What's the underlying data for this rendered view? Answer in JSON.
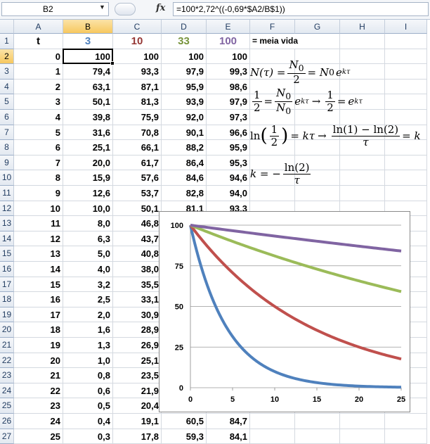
{
  "formula_bar": {
    "name_box": "B2",
    "fx": "fx",
    "formula": "=100*2,72^((-0,69*$A2/B$1))"
  },
  "columns": [
    "A",
    "B",
    "C",
    "D",
    "E",
    "F",
    "G",
    "H",
    "I"
  ],
  "selected_column": "B",
  "selected_row": 2,
  "header_row": {
    "A": "t",
    "B": "3",
    "C": "10",
    "D": "33",
    "E": "100",
    "F": "= meia vida"
  },
  "header_colors": {
    "B": "#4f81bd",
    "C": "#953735",
    "D": "#77933c",
    "E": "#8064a2"
  },
  "rows": [
    [
      "0",
      "100",
      "100",
      "100",
      "100"
    ],
    [
      "1",
      "79,4",
      "93,3",
      "97,9",
      "99,3"
    ],
    [
      "2",
      "63,1",
      "87,1",
      "95,9",
      "98,6"
    ],
    [
      "3",
      "50,1",
      "81,3",
      "93,9",
      "97,9"
    ],
    [
      "4",
      "39,8",
      "75,9",
      "92,0",
      "97,3"
    ],
    [
      "5",
      "31,6",
      "70,8",
      "90,1",
      "96,6"
    ],
    [
      "6",
      "25,1",
      "66,1",
      "88,2",
      "95,9"
    ],
    [
      "7",
      "20,0",
      "61,7",
      "86,4",
      "95,3"
    ],
    [
      "8",
      "15,9",
      "57,6",
      "84,6",
      "94,6"
    ],
    [
      "9",
      "12,6",
      "53,7",
      "82,8",
      "94,0"
    ],
    [
      "10",
      "10,0",
      "50,1",
      "81,1",
      "93,3"
    ],
    [
      "11",
      "8,0",
      "46,8",
      "",
      ""
    ],
    [
      "12",
      "6,3",
      "43,7",
      "",
      ""
    ],
    [
      "13",
      "5,0",
      "40,8",
      "",
      ""
    ],
    [
      "14",
      "4,0",
      "38,0",
      "",
      ""
    ],
    [
      "15",
      "3,2",
      "35,5",
      "",
      ""
    ],
    [
      "16",
      "2,5",
      "33,1",
      "",
      ""
    ],
    [
      "17",
      "2,0",
      "30,9",
      "",
      ""
    ],
    [
      "18",
      "1,6",
      "28,9",
      "",
      ""
    ],
    [
      "19",
      "1,3",
      "26,9",
      "",
      ""
    ],
    [
      "20",
      "1,0",
      "25,1",
      "",
      ""
    ],
    [
      "21",
      "0,8",
      "23,5",
      "",
      ""
    ],
    [
      "22",
      "0,6",
      "21,9",
      "",
      ""
    ],
    [
      "23",
      "0,5",
      "20,4",
      "",
      ""
    ],
    [
      "24",
      "0,4",
      "19,1",
      "60,5",
      "84,7"
    ],
    [
      "25",
      "0,3",
      "17,8",
      "59,3",
      "84,1"
    ]
  ],
  "equations": {
    "eq1": {
      "lhs": "N(τ) =",
      "num": "N",
      "num_sub": "0",
      "den": "2",
      "mid": "= N",
      "mid_sub": "0",
      "e": "e",
      "exp": "kτ"
    },
    "eq2": {
      "a_num": "1",
      "a_den": "2",
      "eq": "=",
      "b_num": "N",
      "b_num_sub": "0",
      "b_den": "N",
      "b_den_sub": "0",
      "e": "e",
      "exp": "kτ",
      "arrow": "→",
      "c_num": "1",
      "c_den": "2",
      "eq2": "=",
      "e2": "e",
      "exp2": "kτ"
    },
    "eq3": {
      "ln": "ln",
      "f_num": "1",
      "f_den": "2",
      "rhs": "= kτ",
      "arrow": "→",
      "g_num": "ln(1) − ln(2)",
      "g_den": "τ",
      "tail": "= k"
    },
    "eq4": {
      "lhs": "k = −",
      "num": "ln(2)",
      "den": "τ"
    }
  },
  "chart_data": {
    "type": "line",
    "xlim": [
      0,
      25
    ],
    "ylim": [
      0,
      100
    ],
    "x_ticks": [
      "0",
      "5",
      "10",
      "15",
      "20",
      "25"
    ],
    "y_ticks": [
      "0",
      "25",
      "50",
      "75",
      "100"
    ],
    "grid": true,
    "series": [
      {
        "half_life": 3,
        "color": "#4f81bd"
      },
      {
        "half_life": 10,
        "color": "#c0504d"
      },
      {
        "half_life": 33,
        "color": "#9bbb59"
      },
      {
        "half_life": 100,
        "color": "#8064a2"
      }
    ]
  }
}
